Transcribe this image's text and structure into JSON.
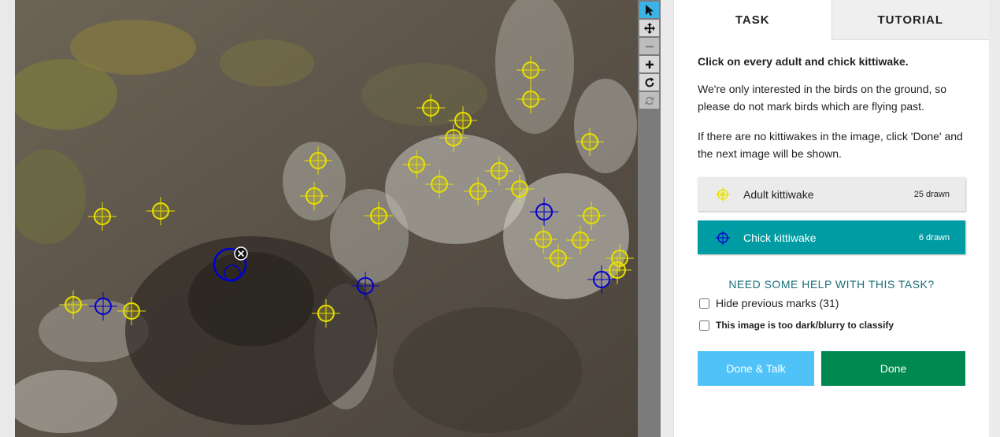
{
  "toolbar": {
    "tools": [
      {
        "name": "pointer",
        "icon": "cursor-arrow-icon",
        "state": "active"
      },
      {
        "name": "pan",
        "icon": "move-arrows-icon",
        "state": "enabled"
      },
      {
        "name": "zoom-out",
        "icon": "minus-icon",
        "state": "disabled"
      },
      {
        "name": "zoom-in",
        "icon": "plus-icon",
        "state": "enabled"
      },
      {
        "name": "rotate",
        "icon": "rotate-icon",
        "state": "enabled"
      },
      {
        "name": "reset",
        "icon": "refresh-icon",
        "state": "disabled"
      }
    ]
  },
  "panel": {
    "tabs": [
      {
        "label": "TASK",
        "active": true
      },
      {
        "label": "TUTORIAL",
        "active": false
      }
    ],
    "instruction": "Click on every adult and chick kittiwake.",
    "paragraphs": [
      "We're only interested in the birds on the ground, so please do not mark birds which are flying past.",
      "If there are no kittiwakes in the image, click 'Done' and the next image will be shown."
    ],
    "choices": [
      {
        "label": "Adult kittiwake",
        "count": "25 drawn",
        "color": "#e7e000",
        "selected": false
      },
      {
        "label": "Chick kittiwake",
        "count": "6 drawn",
        "color": "#0000cc",
        "selected": true
      }
    ],
    "help": "NEED SOME HELP WITH THIS TASK?",
    "hide_marks": "Hide previous marks (31)",
    "too_dark": "This image is too dark/blurry to classify",
    "btn_talk": "Done & Talk",
    "btn_done": "Done"
  },
  "colors": {
    "adult_mark": "#e7e000",
    "chick_mark": "#0000cc",
    "selected_choice": "#009ca3",
    "done_button": "#00894f",
    "talk_button": "#4fc3f7"
  }
}
